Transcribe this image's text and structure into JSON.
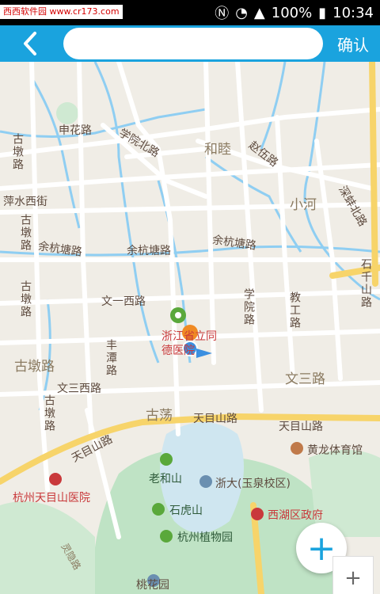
{
  "status_bar": {
    "watermark": "西西软件园 www.cr173.com",
    "battery": "100%",
    "time": "10:34"
  },
  "nav": {
    "search_value": "",
    "confirm_label": "确认"
  },
  "map_labels": {
    "shenhua_rd": "申花路",
    "xueyuan_n_rd": "学院北路",
    "hemu": "和睦",
    "zhaowu_rd": "赵伍路",
    "gudun_rd_1": "古墩路",
    "pingshui_w_st": "萍水西街",
    "xiaohe": "小河",
    "shiqiao_n_rd": "深蚌北路",
    "gudun_rd_2": "古墩路",
    "yuhangtang_rd_1": "余杭塘路",
    "yuhangtang_rd_2": "余杭塘路",
    "yuhangtang_rd_3": "余杭塘路",
    "gudun_rd_3": "古墩路",
    "wenyi_w_rd": "文一西路",
    "xueyuan_rd": "学院路",
    "jiaogong_rd": "教工路",
    "shiqiao_rd": "石千山路",
    "hospital_name": "浙江省立同德医院",
    "fengtan_rd": "丰潭路",
    "gudun_big": "古墩路",
    "wensan_w_rd": "文三西路",
    "wensan_rd": "文三路",
    "gudang": "古荡",
    "gudun_rd_4": "古墩路",
    "tianmushan_rd_1": "天目山路",
    "tianmushan_rd_2": "天目山路",
    "tianmushan_rd_3": "天目山路",
    "huanglong": "黄龙体育馆",
    "laoheshan": "老和山",
    "zju": "浙大(玉泉校区)",
    "tianmushan_hospital": "杭州天目山医院",
    "shihushan": "石虎山",
    "xihu_gov": "西湖区政府",
    "botanical": "杭州植物园",
    "taohuayuan": "桃花园",
    "lingyin_rd": "灵隐路"
  },
  "controls": {
    "zoom_in_label": "+",
    "zoom_small_label": "+"
  },
  "colors": {
    "nav": "#1aa3de",
    "map_bg": "#f0ede6",
    "road": "#ffffff",
    "arterial": "#f7d46a",
    "water": "#8fcef2",
    "green": "#bfe3c5",
    "label": "#5e4b3f",
    "red": "#c9393b"
  }
}
